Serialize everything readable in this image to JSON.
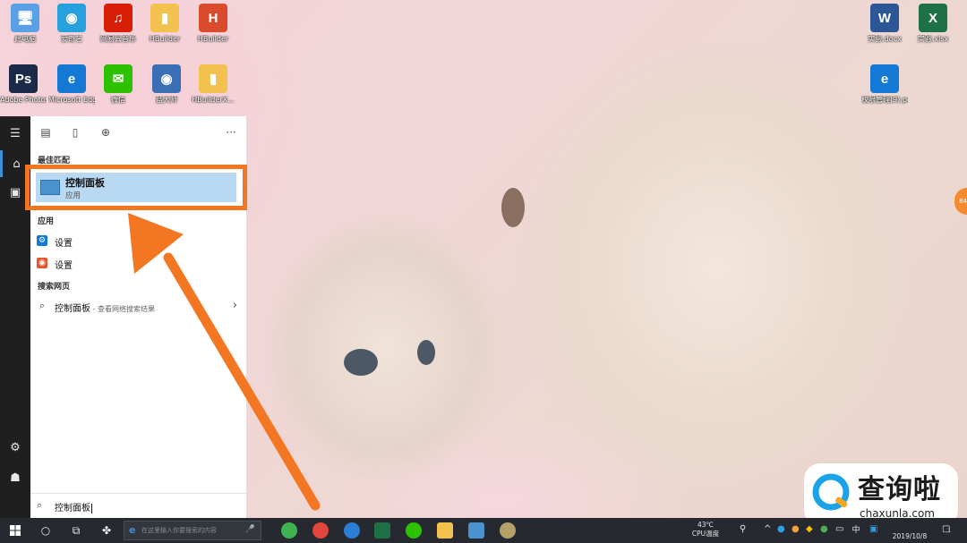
{
  "desktop": {
    "icons_left": [
      {
        "label": "此电脑",
        "icon": "computer-icon",
        "color": "#5aa0e6"
      },
      {
        "label": "爱奇艺",
        "icon": "app-icon",
        "color": "#27a0de"
      },
      {
        "label": "网易云音乐",
        "icon": "music-icon",
        "color": "#d81e06"
      },
      {
        "label": "HBuilder",
        "icon": "folder-icon",
        "color": "#f2c14e"
      },
      {
        "label": "HBuilder",
        "icon": "hbuilder-icon",
        "color": "#d94b2b"
      },
      {
        "label": "Adobe Photosh...",
        "icon": "photoshop-icon",
        "color": "#1c2a4a"
      },
      {
        "label": "Microsoft Edge",
        "icon": "edge-icon",
        "color": "#1479d4"
      },
      {
        "label": "微信",
        "icon": "wechat-icon",
        "color": "#2dc100"
      },
      {
        "label": "蓝大师",
        "icon": "app-icon",
        "color": "#3a6fb5"
      },
      {
        "label": "HBuilderX...",
        "icon": "folder-icon",
        "color": "#f2c14e"
      }
    ],
    "icons_right": [
      {
        "label": "实验.docx",
        "icon": "word-icon",
        "color": "#2b5797"
      },
      {
        "label": "实验.xlsx",
        "icon": "excel-icon",
        "color": "#1e7145"
      },
      {
        "label": "权限管理(9).pdf",
        "icon": "pdf-icon",
        "color": "#1479d4"
      }
    ]
  },
  "start_menu": {
    "toolbar_more": "···",
    "best_match_title": "最佳匹配",
    "best_match": {
      "name": "控制面板",
      "type": "应用"
    },
    "apps_title": "应用",
    "apps": [
      {
        "label": "设置",
        "icon": "settings-icon",
        "color": "#1479d4"
      },
      {
        "label": "设置",
        "icon": "app-icon",
        "color": "#e8542b"
      }
    ],
    "web_title": "搜索网页",
    "web_result": {
      "query": "控制面板",
      "hint": " - 查看网络搜索结果"
    },
    "search_text": "控制面板"
  },
  "taskbar": {
    "search_placeholder": "在这里输入你要搜索的内容",
    "apps": [
      {
        "icon": "app-icon",
        "color": "#3fb34f"
      },
      {
        "icon": "chrome-icon",
        "color": "#e2453c"
      },
      {
        "icon": "app-icon",
        "color": "#2a7ed6"
      },
      {
        "icon": "excel-icon",
        "color": "#1e7145"
      },
      {
        "icon": "wechat-icon",
        "color": "#2dc100"
      },
      {
        "icon": "folder-icon",
        "color": "#f2c14e"
      },
      {
        "icon": "control-panel-icon",
        "color": "#4a93cf"
      },
      {
        "icon": "app-icon",
        "color": "#b5a06a"
      }
    ],
    "temperature": "43℃",
    "temperature_label": "CPU温度",
    "ime": "中",
    "date": "2019/10/8",
    "notifications": "1"
  },
  "watermark": {
    "title": "查询啦",
    "url": "chaxunla.com"
  },
  "side_badge": "84",
  "colors": {
    "accent": "#f37622",
    "selection": "#b9d9f3",
    "taskbar": "#262a30",
    "rail": "#1f1f1f"
  }
}
